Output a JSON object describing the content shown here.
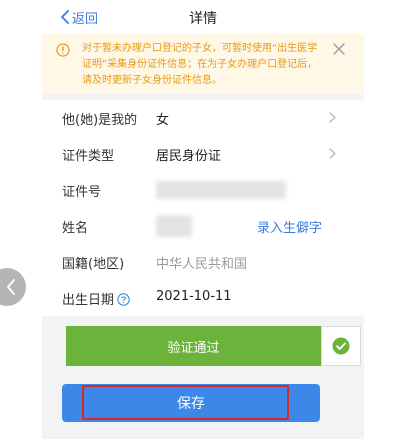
{
  "navbar": {
    "back_label": "返回",
    "title": "详情"
  },
  "notice": {
    "text": "对于暂未办理户口登记的子女，可暂时使用“出生医学证明”采集身份证件信息；在为子女办理户口登记后，请及时更新子女身份证件信息。",
    "color": "#e59a18",
    "background": "#fff8e6"
  },
  "form": {
    "relation": {
      "label": "他(她)是我的",
      "value": "女"
    },
    "id_type": {
      "label": "证件类型",
      "value": "居民身份证"
    },
    "id_number": {
      "label": "证件号"
    },
    "name": {
      "label": "姓名",
      "action": "录入生僻字"
    },
    "nationality": {
      "label": "国籍(地区)",
      "value": "中华人民共和国"
    },
    "birth_date": {
      "label": "出生日期",
      "value": "2021-10-11"
    }
  },
  "verify": {
    "label": "验证通过",
    "color": "#6cb33c"
  },
  "save": {
    "label": "保存",
    "color": "#3d87e8",
    "highlight_color": "#d8262d"
  },
  "icons": {
    "back": "chevron-left-icon",
    "notice": "info-circle-icon",
    "close": "close-icon",
    "chevron": "chevron-right-icon",
    "help": "question-circle-icon",
    "check": "check-circle-icon",
    "side_nav": "chevron-left-icon"
  }
}
